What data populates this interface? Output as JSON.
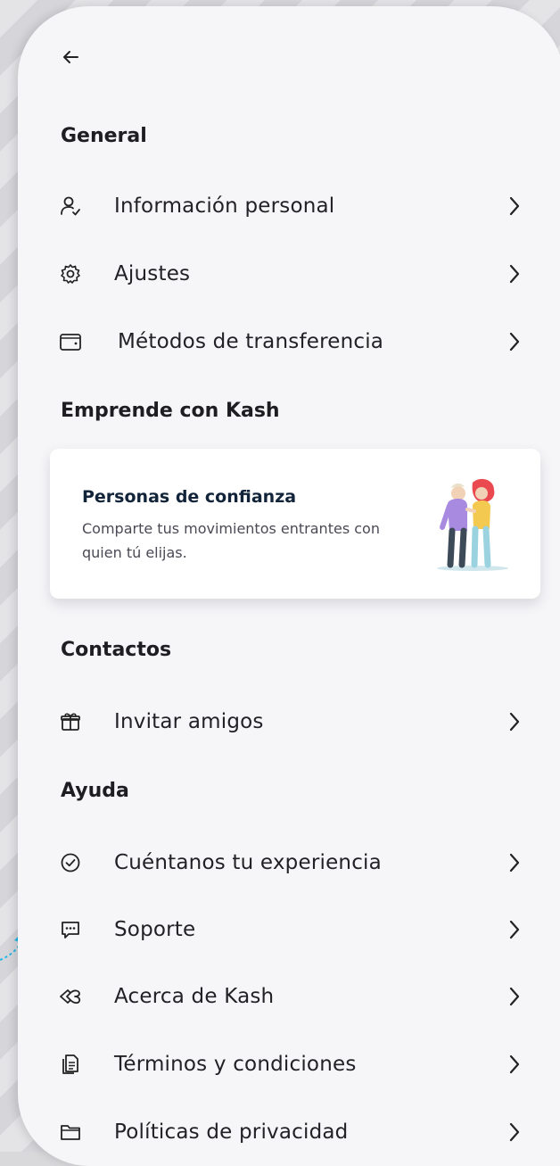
{
  "sections": {
    "general": "General",
    "emprende": "Emprende con Kash",
    "contactos": "Contactos",
    "ayuda": "Ayuda"
  },
  "general_items": [
    {
      "label": "Información personal",
      "icon": "user-check-icon"
    },
    {
      "label": "Ajustes",
      "icon": "gear-icon"
    },
    {
      "label": "Métodos de transferencia",
      "icon": "wallet-icon"
    }
  ],
  "card": {
    "title": "Personas de confianza",
    "description": "Comparte tus movimientos entrantes con quien tú elijas."
  },
  "contactos_items": [
    {
      "label": "Invitar amigos",
      "icon": "gift-icon"
    }
  ],
  "ayuda_items": [
    {
      "label": "Cuéntanos tu experiencia",
      "icon": "check-circle-icon"
    },
    {
      "label": "Soporte",
      "icon": "chat-icon"
    },
    {
      "label": "Acerca de Kash",
      "icon": "kash-logo-icon"
    },
    {
      "label": "Términos y condiciones",
      "icon": "document-icon"
    },
    {
      "label": "Políticas de privacidad",
      "icon": "folder-icon"
    }
  ],
  "colors": {
    "text": "#222226",
    "card_title": "#12243a",
    "accent_arrow": "#22b8e6"
  }
}
